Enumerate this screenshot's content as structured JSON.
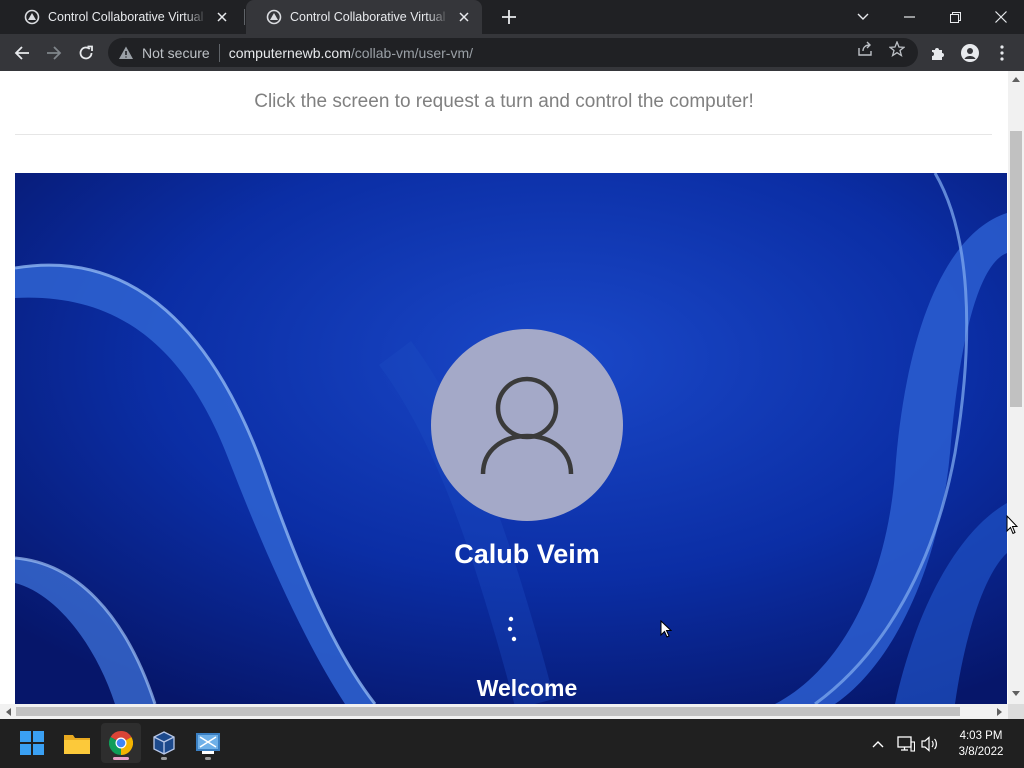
{
  "browser": {
    "tabs": [
      {
        "title": "Control Collaborative Virtual Machine",
        "active": false,
        "favicon": "collab-vm-favicon"
      },
      {
        "title": "Control Collaborative Virtual Machine",
        "active": true,
        "favicon": "collab-vm-favicon"
      }
    ],
    "address_bar": {
      "security_label": "Not secure",
      "host": "computernewb.com",
      "path": "/collab-vm/user-vm/"
    },
    "icons": {
      "back": "back-arrow-icon",
      "forward": "forward-arrow-icon",
      "reload": "reload-icon",
      "share": "share-icon",
      "bookmark": "star-icon",
      "extensions": "puzzle-icon",
      "profile": "profile-icon",
      "menu": "kebab-menu-icon"
    }
  },
  "page": {
    "instruction": "Click the screen to request a turn and control the computer!",
    "vm": {
      "username": "Calub Veim",
      "status": "Welcome"
    }
  },
  "taskbar": {
    "apps": [
      "start-icon",
      "file-explorer-icon",
      "chrome-icon",
      "virtualbox-icon",
      "vmware-icon"
    ],
    "clock": {
      "time": "4:03 PM",
      "date": "3/8/2022"
    }
  },
  "colors": {
    "chrome_dark": "#202124",
    "chrome_toolbar": "#35363a",
    "wallpaper_blue": "#0a2a9a",
    "avatar_bg": "#a4a9c8"
  }
}
